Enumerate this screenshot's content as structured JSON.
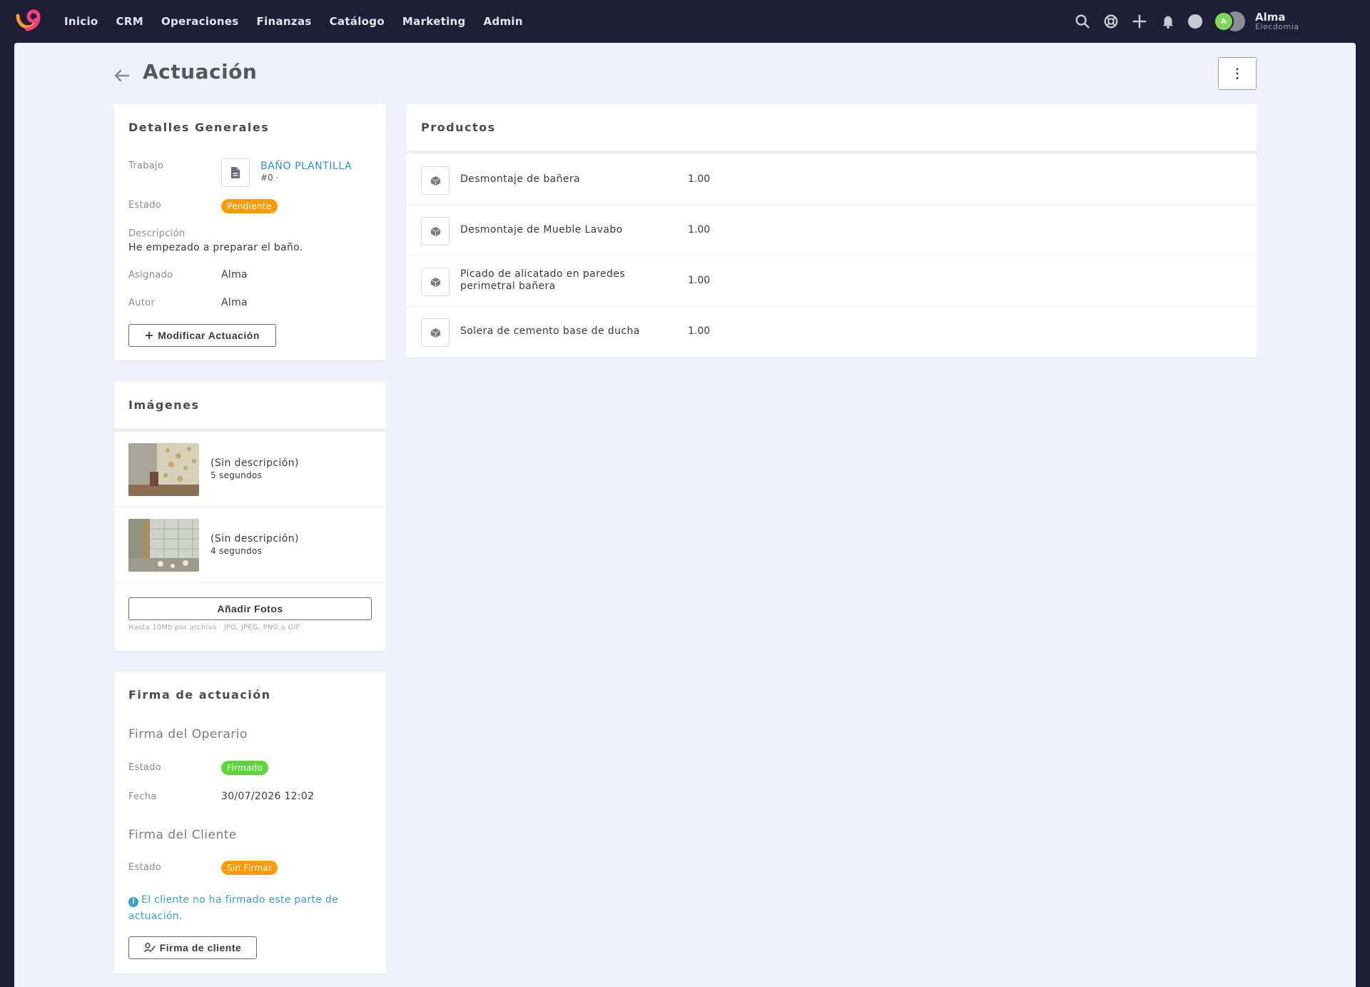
{
  "nav": {
    "items": [
      "Inicio",
      "CRM",
      "Operaciones",
      "Finanzas",
      "Catálogo",
      "Marketing",
      "Admin"
    ]
  },
  "user": {
    "initial": "A",
    "name": "Alma",
    "org": "Elecdomia"
  },
  "page": {
    "title": "Actuación",
    "more_label": "⋮"
  },
  "details": {
    "title": "Detalles Generales",
    "trabajo_label": "Trabajo",
    "trabajo_name": "BAÑO PLANTILLA",
    "trabajo_number": "#0 ·",
    "estado_label": "Estado",
    "estado_value": "Pendiente",
    "descripcion_label": "Descripción",
    "descripcion_value": "He empezado a preparar el baño.",
    "asignado_label": "Asignado",
    "asignado_value": "Alma",
    "autor_label": "Autor",
    "autor_value": "Alma",
    "modify_button": "Modificar Actuación"
  },
  "products": {
    "title": "Productos",
    "items": [
      {
        "name": "Desmontaje de bañera",
        "qty": "1.00"
      },
      {
        "name": "Desmontaje de Mueble Lavabo",
        "qty": "1.00"
      },
      {
        "name": "Picado de alicatado en paredes perimetral bañera",
        "qty": "1.00"
      },
      {
        "name": "Solera de cemento base de ducha",
        "qty": "1.00"
      }
    ]
  },
  "images": {
    "title": "Imágenes",
    "items": [
      {
        "description": "(Sin descripción)",
        "time": "5 segundos"
      },
      {
        "description": "(Sin descripción)",
        "time": "4 segundos"
      }
    ],
    "add_button": "Añadir Fotos",
    "hint": "Hasta 10Mb por archivo · JPG, JPEG, PNG o GIF"
  },
  "signature": {
    "title": "Firma de actuación",
    "operator_title": "Firma del Operario",
    "operator_estado_label": "Estado",
    "operator_estado_value": "Firmado",
    "operator_fecha_label": "Fecha",
    "operator_fecha_value": "30/07/2026 12:02",
    "client_title": "Firma del Cliente",
    "client_estado_label": "Estado",
    "client_estado_value": "Sin Firmar",
    "client_info": "El cliente no ha firmado este parte de actuación.",
    "client_button": "Firma de cliente"
  },
  "colors": {
    "nav_bg": "#1f1e36",
    "page_bg": "#eff2fa",
    "link": "#2f8fca",
    "pending": "#ff9a00",
    "signed": "#5dd43a",
    "info": "#3a9fce"
  }
}
